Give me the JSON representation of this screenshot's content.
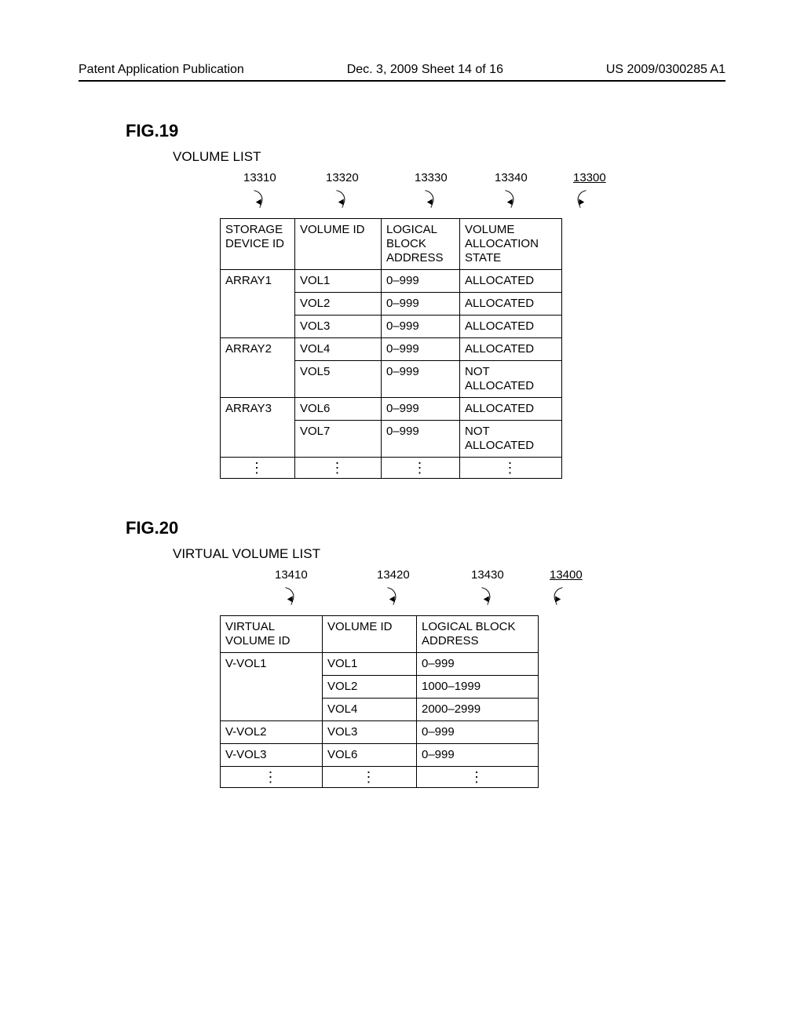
{
  "header": {
    "left": "Patent Application Publication",
    "center": "Dec. 3, 2009  Sheet 14 of 16",
    "right": "US 2009/0300285 A1"
  },
  "fig19": {
    "label": "FIG.19",
    "title": "VOLUME LIST",
    "refs": {
      "c1": "13310",
      "c2": "13320",
      "c3": "13330",
      "c4": "13340",
      "table": "13300"
    },
    "columns": {
      "c1": "STORAGE DEVICE ID",
      "c2": "VOLUME ID",
      "c3": "LOGICAL BLOCK ADDRESS",
      "c4": "VOLUME ALLOCATION STATE"
    },
    "rows": [
      {
        "sid": "ARRAY1",
        "vol": "VOL1",
        "lba": "0–999",
        "state": "ALLOCATED",
        "span": 3
      },
      {
        "sid": "",
        "vol": "VOL2",
        "lba": "0–999",
        "state": "ALLOCATED"
      },
      {
        "sid": "",
        "vol": "VOL3",
        "lba": "0–999",
        "state": "ALLOCATED"
      },
      {
        "sid": "ARRAY2",
        "vol": "VOL4",
        "lba": "0–999",
        "state": "ALLOCATED",
        "span": 2
      },
      {
        "sid": "",
        "vol": "VOL5",
        "lba": "0–999",
        "state": "NOT ALLOCATED"
      },
      {
        "sid": "ARRAY3",
        "vol": "VOL6",
        "lba": "0–999",
        "state": "ALLOCATED",
        "span": 2
      },
      {
        "sid": "",
        "vol": "VOL7",
        "lba": "0–999",
        "state": "NOT ALLOCATED"
      }
    ],
    "vdots": "⋮"
  },
  "fig20": {
    "label": "FIG.20",
    "title": "VIRTUAL VOLUME LIST",
    "refs": {
      "c1": "13410",
      "c2": "13420",
      "c3": "13430",
      "table": "13400"
    },
    "columns": {
      "c1": "VIRTUAL VOLUME ID",
      "c2": "VOLUME ID",
      "c3": "LOGICAL BLOCK ADDRESS"
    },
    "rows": [
      {
        "vvid": "V-VOL1",
        "vol": "VOL1",
        "lba": "0–999",
        "span": 3
      },
      {
        "vvid": "",
        "vol": "VOL2",
        "lba": "1000–1999"
      },
      {
        "vvid": "",
        "vol": "VOL4",
        "lba": "2000–2999"
      },
      {
        "vvid": "V-VOL2",
        "vol": "VOL3",
        "lba": "0–999",
        "span": 1
      },
      {
        "vvid": "V-VOL3",
        "vol": "VOL6",
        "lba": "0–999",
        "span": 1
      }
    ],
    "vdots": "⋮"
  }
}
